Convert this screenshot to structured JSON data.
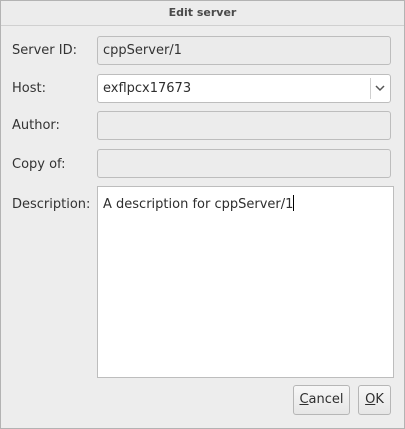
{
  "window": {
    "title": "Edit server"
  },
  "form": {
    "server_id": {
      "label": "Server ID:",
      "value": "cppServer/1"
    },
    "host": {
      "label": "Host:",
      "value": "exflpcx17673"
    },
    "author": {
      "label": "Author:",
      "value": ""
    },
    "copy_of": {
      "label": "Copy of:",
      "value": ""
    },
    "description": {
      "label": "Description:",
      "value": "A description for cppServer/1"
    }
  },
  "buttons": {
    "cancel": {
      "mnemonic": "C",
      "rest": "ancel"
    },
    "ok": {
      "mnemonic": "O",
      "rest": "K"
    }
  },
  "icons": {
    "dropdown": "chevron-down-icon"
  }
}
